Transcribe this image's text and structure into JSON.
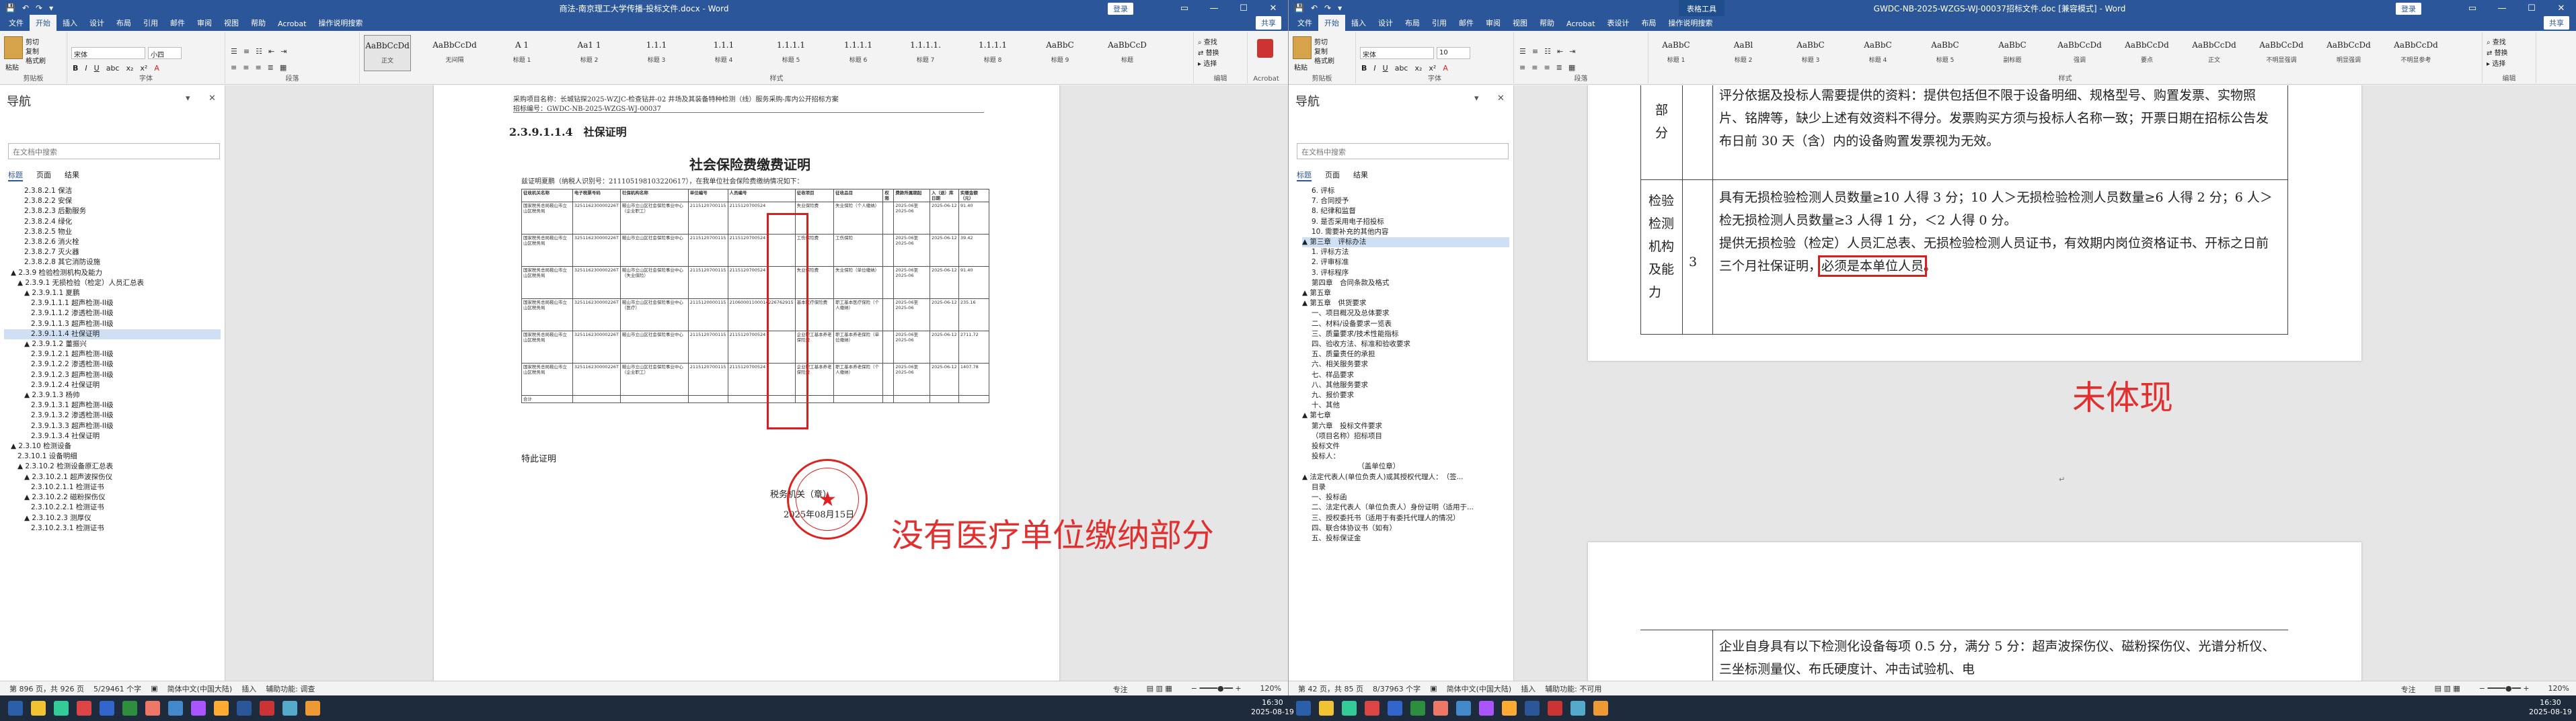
{
  "left": {
    "title": "商法-南京理工大学传播-投标文件.docx - Word",
    "quick_access": [
      "保存",
      "撤销",
      "恢复",
      "自定义"
    ],
    "login": "登录",
    "share": "共享",
    "tabs": [
      "文件",
      "开始",
      "插入",
      "设计",
      "布局",
      "引用",
      "邮件",
      "审阅",
      "视图",
      "帮助",
      "Acrobat",
      "操作说明搜索"
    ],
    "ribbon": {
      "clipboard": {
        "paste": "粘贴",
        "cut": "剪切",
        "copy": "复制",
        "painter": "格式刷",
        "label": "剪贴板"
      },
      "font": {
        "name": "宋体",
        "size": "小四",
        "label": "字体"
      },
      "paragraph_label": "段落",
      "styles": [
        {
          "sample": "AaBbCcDd",
          "name": "正文"
        },
        {
          "sample": "AaBbCcDd",
          "name": "无间隔"
        },
        {
          "sample": "A 1",
          "name": "标题 1"
        },
        {
          "sample": "Aa1 1",
          "name": "标题 2"
        },
        {
          "sample": "1.1.1",
          "name": "标题 3"
        },
        {
          "sample": "1.1.1",
          "name": "标题 4"
        },
        {
          "sample": "1.1.1.1",
          "name": "标题 5"
        },
        {
          "sample": "1.1.1.1",
          "name": "标题 6"
        },
        {
          "sample": "1.1.1.1.",
          "name": "标题 7"
        },
        {
          "sample": "1.1.1.1",
          "name": "标题 8"
        },
        {
          "sample": "AaBbC",
          "name": "标题 9"
        },
        {
          "sample": "AaBbCcD",
          "name": "标题"
        }
      ],
      "styles_label": "样式",
      "editing": {
        "find": "查找",
        "replace": "替换",
        "select": "选择",
        "label": "编辑"
      },
      "acrobat": "Acrobat"
    },
    "nav": {
      "title": "导航",
      "search_placeholder": "在文档中搜索",
      "tabs": [
        "标题",
        "页面",
        "结果"
      ],
      "items": [
        "2.3.8.2.1 保洁",
        "2.3.8.2.2 安保",
        "2.3.8.2.3 后勤服务",
        "2.3.8.2.4 绿化",
        "2.3.8.2.5 物业",
        "2.3.8.2.6 消火栓",
        "2.3.8.2.7 灭火器",
        "2.3.8.2.8 其它消防设施",
        "▲ 2.3.9 检验检测机构及能力",
        "▲ 2.3.9.1 无损检验（检定）人员汇总表",
        "▲ 2.3.9.1.1 夏鹏",
        "2.3.9.1.1.1 超声检测-II级",
        "2.3.9.1.1.2 渗透检测-II级",
        "2.3.9.1.1.3 超声检测-II级",
        "2.3.9.1.1.4 社保证明",
        "▲ 2.3.9.1.2 董振兴",
        "2.3.9.1.2.1 超声检测-II级",
        "2.3.9.1.2.2 渗透检测-II级",
        "2.3.9.1.2.3 超声检测-II级",
        "2.3.9.1.2.4 社保证明",
        "▲ 2.3.9.1.3 杨帅",
        "2.3.9.1.3.1 超声检测-II级",
        "2.3.9.1.3.2 渗透检测-II级",
        "2.3.9.1.3.3 超声检测-II级",
        "2.3.9.1.3.4 社保证明",
        "▲ 2.3.10 检测设备",
        "2.3.10.1 设备明细",
        "▲ 2.3.10.2 检测设备原汇总表",
        "▲ 2.3.10.2.1 超声波探伤仪",
        "2.3.10.2.1.1 检测证书",
        "▲ 2.3.10.2.2 磁粉探伤仪",
        "2.3.10.2.2.1 检测证书",
        "▲ 2.3.10.2.3 测厚仪",
        "2.3.10.2.3.1 检测证书"
      ],
      "highlight_index": 14
    },
    "doc": {
      "header_line1": "采购项目名称：长城钻探2025-WZJC-检查钻井-02 井场及其装备特种检测（线）服务采购-库内公开招标方案",
      "header_line2": "招标编号：GWDC-NB-2025-WZGS-WJ-00037",
      "heading": "2.3.9.1.1.4　社保证明",
      "cert_title": "社会保险费缴费证明",
      "cert_intro": "兹证明夏鹏（纳税人识别号：211105198103220617），在我单位社会保险费缴纳情况如下：",
      "table_headers": [
        "征收机关名称",
        "电子税票号码",
        "社保机构名称",
        "单位编号",
        "人员编号",
        "征收项目",
        "征收品目",
        "权限",
        "费款所属期起",
        "入（退）库日期",
        "实缴金额（元）"
      ],
      "table_rows": [
        [
          "国家税务总局鞍山市立山区税务局",
          "325116230000226T",
          "鞍山市立山区社会保险事业中心（企业职工）",
          "2115120700115",
          "2115120700524",
          "失业保险费",
          "失业保险（个人缴纳）",
          "",
          "2025-06至2025-06",
          "2025-06-12",
          "91.40"
        ],
        [
          "国家税务总局鞍山市立山区税务局",
          "325116230000226T",
          "鞍山市立山区社会保险事业中心",
          "2115120700115",
          "2115120700524",
          "工伤保险费",
          "工伤保险",
          "",
          "2025-06至2025-06",
          "2025-06-12",
          "39.42"
        ],
        [
          "国家税务总局鞍山市立山区税务局",
          "325116230000226T",
          "鞍山市立山区社会保险事业中心（失业保险）",
          "2115120700115",
          "2115120700524",
          "失业保险费",
          "失业保险（单位缴纳）",
          "",
          "2025-06至2025-06",
          "2025-06-12",
          "91.40"
        ],
        [
          "国家税务总局鞍山市立山区税务局",
          "325116230000226T",
          "鞍山市立山区社会保险事业中心（医疗）",
          "2115120000115",
          "21060001100014226762915",
          "基本医疗保险费",
          "职工基本医疗保险（个人缴纳）",
          "",
          "2025-06至2025-06",
          "2025-06-12",
          "235.16"
        ],
        [
          "国家税务总局鞍山市立山区税务局",
          "325116230000226T",
          "鞍山市立山区社会保险事业中心",
          "2115120700115",
          "2115120700524",
          "企业职工基本养老保险费",
          "职工基本养老保险（单位缴纳）",
          "",
          "2025-06至2025-06",
          "2025-06-12",
          "2711.72"
        ],
        [
          "国家税务总局鞍山市立山区税务局",
          "325116230000226T",
          "鞍山市立山区社会保险事业中心（企业职工）",
          "2115120700115",
          "2115120700524",
          "企业职工基本养老保险费",
          "职工基本养老保险（个人缴纳）",
          "",
          "2025-06至2025-06",
          "2025-06-12",
          "1407.78"
        ]
      ],
      "total_label": "合计",
      "special": "特此证明",
      "sig_line": "税务机关（章）",
      "date": "2025年08月15日",
      "annotation": "没有医疗单位缴纳部分"
    },
    "status": {
      "page": "第 896 页，共 926 页",
      "words": "5/29461 个字",
      "lang": "简体中文(中国大陆)",
      "insert": "插入",
      "auxiliary": "辅助功能: 调查",
      "zoom": "120%",
      "focus": "专注"
    }
  },
  "right": {
    "title": "GWDC-NB-2025-WZGS-WJ-00037招标文件.doc [兼容模式] - Word",
    "context_tab": "表格工具",
    "login": "登录",
    "share": "共享",
    "tabs": [
      "文件",
      "开始",
      "插入",
      "设计",
      "布局",
      "引用",
      "邮件",
      "审阅",
      "视图",
      "帮助",
      "Acrobat",
      "表设计",
      "布局",
      "操作说明搜索"
    ],
    "ribbon": {
      "font": {
        "name": "宋体",
        "size": "10"
      },
      "styles": [
        {
          "sample": "AaBbC",
          "name": "标题 1"
        },
        {
          "sample": "AaBl",
          "name": "标题 2"
        },
        {
          "sample": "AaBbC",
          "name": "标题 3"
        },
        {
          "sample": "AaBbC",
          "name": "标题 4"
        },
        {
          "sample": "AaBbC",
          "name": "标题 5"
        },
        {
          "sample": "AaBbC",
          "name": "副标题"
        },
        {
          "sample": "AaBbCcDd",
          "name": "强调"
        },
        {
          "sample": "AaBbCcDd",
          "name": "要点"
        },
        {
          "sample": "AaBbCcDd",
          "name": "正文"
        },
        {
          "sample": "AaBbCcDd",
          "name": "不明显强调"
        },
        {
          "sample": "AaBbCcDd",
          "name": "明显强调"
        },
        {
          "sample": "AaBbCcDd",
          "name": "不明显参考"
        }
      ]
    },
    "nav": {
      "title": "导航",
      "search_placeholder": "在文档中搜索",
      "tabs": [
        "标题",
        "页面",
        "结果"
      ],
      "items": [
        "6. 评标",
        "7. 合同授予",
        "8. 纪律和监督",
        "9. 是否采用电子招投标",
        "10. 需要补充的其他内容",
        "▲ 第三章　评标办法",
        "1. 评标方法",
        "2. 评审标准",
        "3. 评标程序",
        "第四章　合同条款及格式",
        "▲ 第五章",
        "▲ 第五章　供货要求",
        "一、项目概况及总体要求",
        "二、材料/设备要求一览表",
        "三、质量要求/技术性能指标",
        "四、验收方法、标准和验收要求",
        "五、质量责任的承担",
        "六、相关服务要求",
        "七、样品要求",
        "八、其他服务要求",
        "九、报价要求",
        "十、其他",
        "▲ 第七章",
        "第六章　投标文件要求",
        "（项目名称）招标项目",
        "投标文件",
        "投标人：",
        "　　　　　　　（盖单位章）",
        "▲ 法定代表人(单位负责人)或其授权代理人：　（签...",
        "目录",
        "一、投标函",
        "二、法定代表人（单位负责人）身份证明（适用于...",
        "三、授权委托书（适用于有委托代理人的情况）",
        "四、联合体协议书（如有）",
        "五、投标保证金"
      ],
      "highlight_index": 5
    },
    "doc": {
      "row0_label": "部分",
      "row0_text": "评分依据及投标人需要提供的资料：提供包括但不限于设备明细、规格型号、购置发票、实物照片、铭牌等，缺少上述有效资料不得分。发票购买方须与投标人名称一致；开票日期在招标公告发布日前 30 天（含）内的设备购置发票视为无效。",
      "row1_label": "检验检测机构及能力",
      "row1_score": "3",
      "row1_text1": "具有无损检验检测人员数量≥10 人得 3 分；10 人＞无损检验检测人员数量≥6 人得 2 分；6 人＞检无损检测人员数量≥3 人得 1 分，＜2 人得 0 分。",
      "row1_text2": "提供无损检验（检定）人员汇总表、无损检验检测人员证书，有效期内岗位资格证书、开标之日前三个月社保证明，",
      "row1_boxed": "必须是本单位人员",
      "row1_end": "。",
      "row2_text": "企业自身具有以下检测化设备每项 0.5 分，满分 5 分：超声波探伤仪、磁粉探伤仪、光谱分析仪、三坐标测量仪、布氏硬度计、冲击试验机、电",
      "annotation": "未体现",
      "page_marker": "↵"
    },
    "status": {
      "page": "第 42 页，共 85 页",
      "words": "8/37963 个字",
      "lang": "简体中文(中国大陆)",
      "insert": "插入",
      "auxiliary": "辅助功能: 不可用",
      "zoom": "120%",
      "focus": "专注"
    }
  },
  "taskbar": {
    "time": "16:30",
    "date": "2025-08-19"
  },
  "colors": {
    "word_blue": "#2b579a",
    "annotation_red": "#e03030",
    "highlight": "#cfe0f4"
  }
}
